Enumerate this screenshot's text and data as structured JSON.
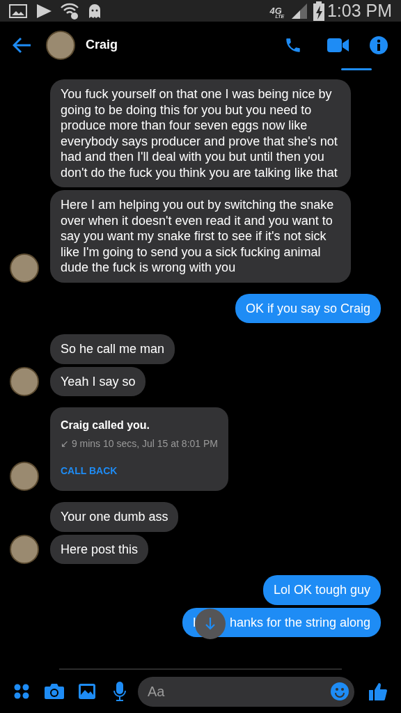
{
  "status_bar": {
    "network": "4G",
    "network_sub": "LTE",
    "time": "1:03 PM"
  },
  "header": {
    "name": "Craig"
  },
  "messages": [
    {
      "kind": "incoming",
      "avatar": false,
      "text": "You fuck yourself on that one I was being nice by going to be doing this for you but you need to produce more than four seven eggs now like everybody says producer and prove that she's not had and then I'll deal with you but until then you don't do the fuck you think you are talking like that"
    },
    {
      "kind": "incoming",
      "avatar": true,
      "text": "Here I am helping you out by switching the snake over when it doesn't even read it and you want to say you want my snake first to see if it's not sick like I'm going to send you a sick fucking animal dude the fuck is wrong with you"
    },
    {
      "kind": "outgoing",
      "text": "OK if you say so Craig"
    },
    {
      "kind": "incoming",
      "avatar": false,
      "text": "So he call me man"
    },
    {
      "kind": "incoming",
      "avatar": true,
      "text": "Yeah I say so"
    },
    {
      "kind": "call",
      "avatar": true,
      "title": "Craig called you.",
      "detail": "↙ 9 mins 10 secs, Jul 15 at 8:01 PM",
      "action": "CALL BACK"
    },
    {
      "kind": "incoming",
      "avatar": false,
      "text": "Your one dumb ass"
    },
    {
      "kind": "incoming",
      "avatar": true,
      "text": "Here post this"
    },
    {
      "kind": "outgoing",
      "text": "Lol OK tough guy"
    },
    {
      "kind": "covered",
      "text_start": "I",
      "text_end": "hanks for the string along"
    }
  ],
  "composer": {
    "placeholder": "Aa"
  }
}
